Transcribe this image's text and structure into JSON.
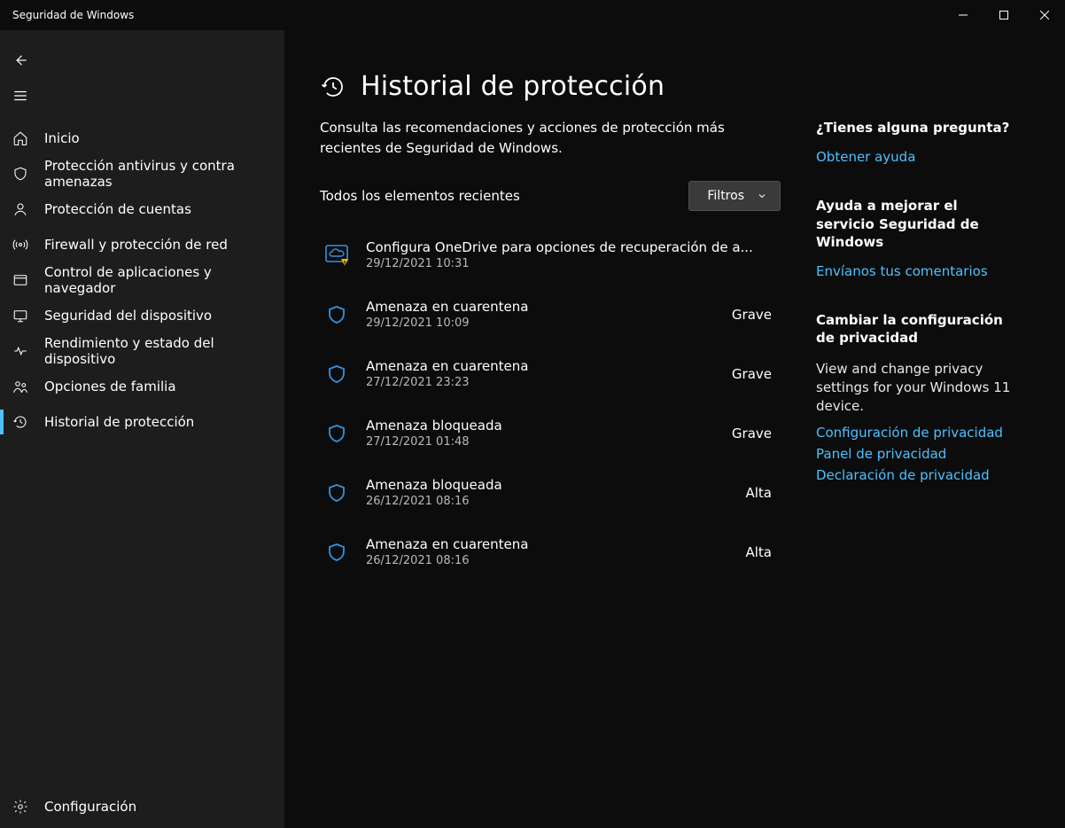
{
  "window": {
    "title": "Seguridad de Windows"
  },
  "sidebar": {
    "items": [
      {
        "label": "Inicio"
      },
      {
        "label": "Protección antivirus y contra amenazas"
      },
      {
        "label": "Protección de cuentas"
      },
      {
        "label": "Firewall y protección de red"
      },
      {
        "label": "Control de aplicaciones y navegador"
      },
      {
        "label": "Seguridad del dispositivo"
      },
      {
        "label": "Rendimiento y estado del dispositivo"
      },
      {
        "label": "Opciones de familia"
      },
      {
        "label": "Historial de protección"
      }
    ],
    "settings_label": "Configuración"
  },
  "page": {
    "title": "Historial de protección",
    "subtitle": "Consulta las recomendaciones y acciones de protección más recientes de Seguridad de Windows.",
    "list_header": "Todos los elementos recientes",
    "filter_label": "Filtros"
  },
  "events": [
    {
      "title": "Configura OneDrive para opciones de recuperación de a...",
      "date": "29/12/2021 10:31",
      "severity": "",
      "icon": "onedrive-warning"
    },
    {
      "title": "Amenaza en cuarentena",
      "date": "29/12/2021 10:09",
      "severity": "Grave",
      "icon": "shield-blue"
    },
    {
      "title": "Amenaza en cuarentena",
      "date": "27/12/2021 23:23",
      "severity": "Grave",
      "icon": "shield-blue"
    },
    {
      "title": "Amenaza bloqueada",
      "date": "27/12/2021 01:48",
      "severity": "Grave",
      "icon": "shield-blue"
    },
    {
      "title": "Amenaza bloqueada",
      "date": "26/12/2021 08:16",
      "severity": "Alta",
      "icon": "shield-blue"
    },
    {
      "title": "Amenaza en cuarentena",
      "date": "26/12/2021 08:16",
      "severity": "Alta",
      "icon": "shield-blue"
    }
  ],
  "side": {
    "help": {
      "heading": "¿Tienes alguna pregunta?",
      "link": "Obtener ayuda"
    },
    "improve": {
      "heading": "Ayuda a mejorar el servicio Seguridad de Windows",
      "link": "Envíanos tus comentarios"
    },
    "privacy": {
      "heading": "Cambiar la configuración de privacidad",
      "text": "View and change privacy settings for your Windows 11 device.",
      "links": [
        "Configuración de privacidad",
        "Panel de privacidad",
        "Declaración de privacidad"
      ]
    }
  }
}
